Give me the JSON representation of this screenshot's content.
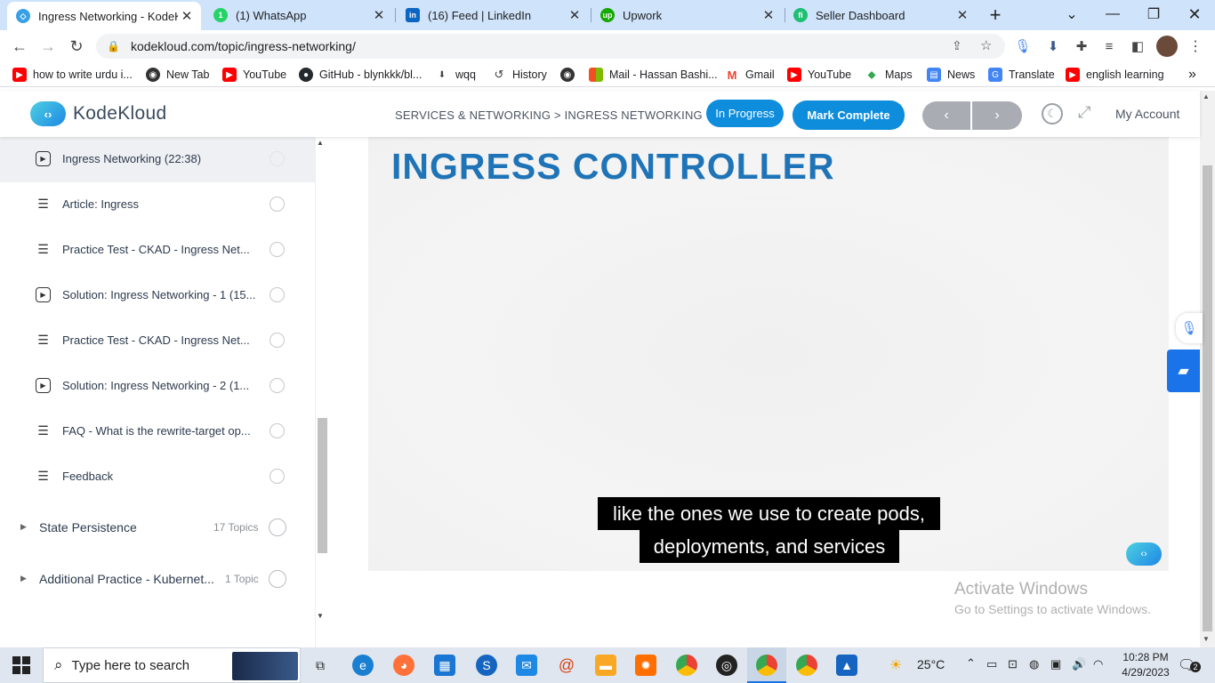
{
  "browser": {
    "tabs": [
      {
        "title": "Ingress Networking - KodeKl",
        "icon": "kodekloud-favicon",
        "active": true
      },
      {
        "title": "(1) WhatsApp",
        "icon": "whatsapp-favicon"
      },
      {
        "title": "(16) Feed | LinkedIn",
        "icon": "linkedin-favicon"
      },
      {
        "title": "Upwork",
        "icon": "upwork-favicon"
      },
      {
        "title": "Seller Dashboard",
        "icon": "fiverr-favicon"
      }
    ],
    "new_tab": "+",
    "url": "kodekloud.com/topic/ingress-networking/",
    "bookmarks": [
      {
        "label": "how to write urdu i...",
        "icon": "youtube-icon",
        "color": "#ff0000"
      },
      {
        "label": "New Tab",
        "icon": "globe-icon",
        "color": "#333333"
      },
      {
        "label": "YouTube",
        "icon": "youtube-icon",
        "color": "#ff0000"
      },
      {
        "label": "GitHub - blynkkk/bl...",
        "icon": "github-icon",
        "color": "#24292e"
      },
      {
        "label": "wqq",
        "icon": "download-icon",
        "color": "#444444"
      },
      {
        "label": "History",
        "icon": "history-icon",
        "color": "#444444"
      },
      {
        "label": "",
        "icon": "globe-icon",
        "color": "#333333"
      },
      {
        "label": "Mail - Hassan Bashi...",
        "icon": "microsoft-icon",
        "color": "#f25022"
      },
      {
        "label": "Gmail",
        "icon": "gmail-icon",
        "color": "#ea4335"
      },
      {
        "label": "YouTube",
        "icon": "youtube-icon",
        "color": "#ff0000"
      },
      {
        "label": "Maps",
        "icon": "maps-icon",
        "color": "#34a853"
      },
      {
        "label": "News",
        "icon": "news-icon",
        "color": "#4285f4"
      },
      {
        "label": "Translate",
        "icon": "translate-icon",
        "color": "#4285f4"
      },
      {
        "label": "english learning",
        "icon": "youtube-icon",
        "color": "#ff0000"
      }
    ],
    "more_bookmarks": "»"
  },
  "header": {
    "brand": "KodeKloud",
    "breadcrumb": "SERVICES & NETWORKING > INGRESS NETWORKING",
    "status": "In Progress",
    "mark_complete": "Mark Complete",
    "prev": "‹",
    "next": "›",
    "account": "My Account",
    "accent": "#0e8ddc"
  },
  "sidebar": {
    "items": [
      {
        "label": "Ingress Networking (22:38)",
        "type": "video",
        "active": true
      },
      {
        "label": "Article: Ingress",
        "type": "article"
      },
      {
        "label": "Practice Test - CKAD - Ingress Net...",
        "type": "article"
      },
      {
        "label": "Solution: Ingress Networking - 1 (15...",
        "type": "video"
      },
      {
        "label": "Practice Test - CKAD - Ingress Net...",
        "type": "article"
      },
      {
        "label": "Solution: Ingress Networking - 2 (1...",
        "type": "video"
      },
      {
        "label": "FAQ - What is the rewrite-target op...",
        "type": "article"
      },
      {
        "label": "Feedback",
        "type": "article"
      }
    ],
    "sections": [
      {
        "label": "State Persistence",
        "count": "17 Topics"
      },
      {
        "label": "Additional Practice - Kubernet...",
        "count": "1 Topic"
      }
    ]
  },
  "video": {
    "title": "INGRESS CONTROLLER",
    "caption_lines": [
      "like the ones we use to create pods,",
      "deployments, and services"
    ]
  },
  "watermark": {
    "line1": "Activate Windows",
    "line2": "Go to Settings to activate Windows."
  },
  "taskbar": {
    "search_placeholder": "Type here to search",
    "weather": "25°C",
    "time": "10:28 PM",
    "date": "4/29/2023",
    "notifications": "2"
  }
}
